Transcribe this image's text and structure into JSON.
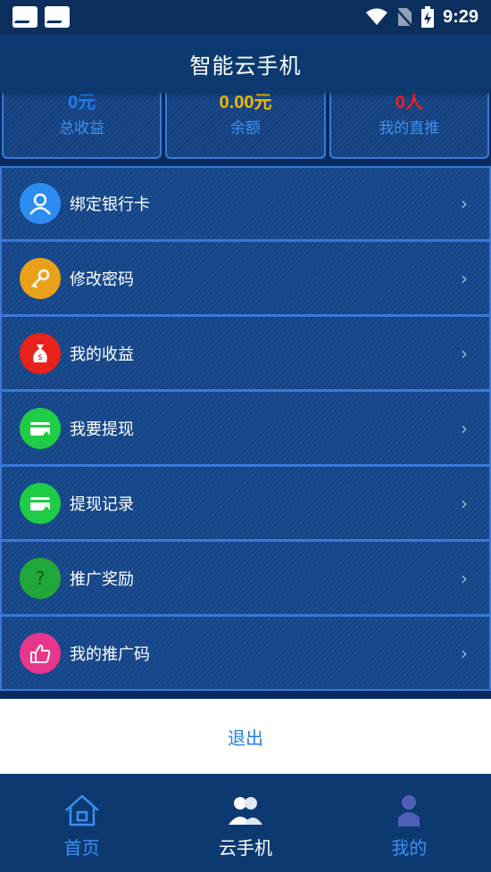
{
  "status_bar": {
    "time": "9:29"
  },
  "header": {
    "title": "智能云手机"
  },
  "stats": [
    {
      "value": "0元",
      "label": "总收益",
      "value_color": "#1e7bf0"
    },
    {
      "value": "0.00元",
      "label": "余额",
      "value_color": "#f0b800"
    },
    {
      "value": "0人",
      "label": "我的直推",
      "value_color": "#e8231c"
    }
  ],
  "menu": {
    "items": [
      {
        "label": "绑定银行卡",
        "icon": "user-icon",
        "icon_color": "#2d8cf0"
      },
      {
        "label": "修改密码",
        "icon": "key-icon",
        "icon_color": "#e8a21a"
      },
      {
        "label": "我的收益",
        "icon": "money-bag-icon",
        "icon_color": "#e8231c"
      },
      {
        "label": "我要提现",
        "icon": "withdraw-card-icon",
        "icon_color": "#1fcc45"
      },
      {
        "label": "提现记录",
        "icon": "withdraw-record-icon",
        "icon_color": "#1fcc45"
      },
      {
        "label": "推广奖励",
        "icon": "question-icon",
        "icon_color": "#22a83a"
      },
      {
        "label": "我的推广码",
        "icon": "thumbs-up-icon",
        "icon_color": "#e8368a"
      }
    ],
    "chevron": "›"
  },
  "logout": {
    "label": "退出"
  },
  "tabs": [
    {
      "label": "首页",
      "icon": "home-icon",
      "color": "#3c8ff0"
    },
    {
      "label": "云手机",
      "icon": "users-icon",
      "color": "#ffffff"
    },
    {
      "label": "我的",
      "icon": "person-icon",
      "color": "#3c8ff0"
    }
  ]
}
